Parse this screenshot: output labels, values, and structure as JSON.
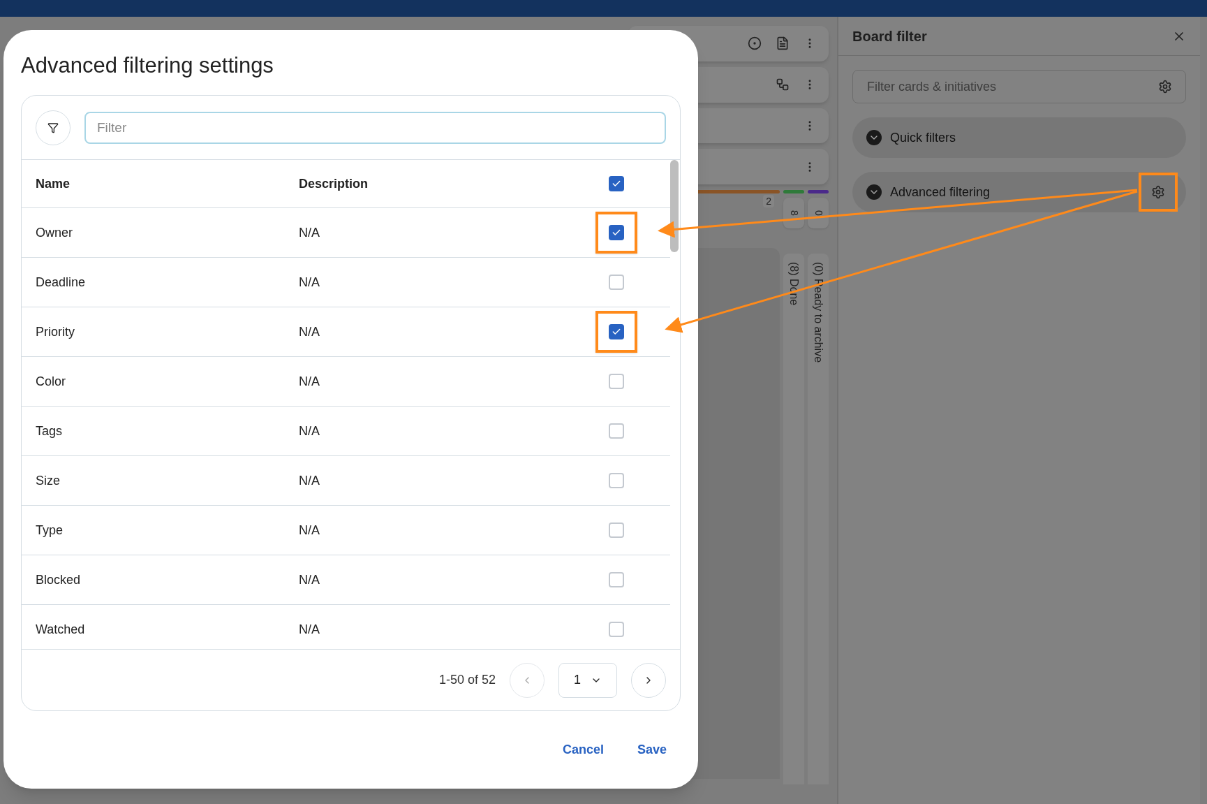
{
  "board": {
    "cards": [
      {
        "kind": "target"
      },
      {
        "kind": "workflow"
      },
      {
        "kind": "plain"
      },
      {
        "kind": "plain"
      }
    ],
    "lanes": [
      {
        "color": "#8a5426",
        "count": "2"
      },
      {
        "color": "#2f7a3a",
        "count": "8",
        "title": "(8) Done"
      },
      {
        "color": "#4b2a8a",
        "count": "0",
        "title": "(0) Ready to archive"
      }
    ]
  },
  "board_filter": {
    "title": "Board filter",
    "search": {
      "placeholder": "Filter cards & initiatives"
    },
    "sections": [
      {
        "label": "Quick filters",
        "highlighted": false
      },
      {
        "label": "Advanced filtering",
        "highlighted": true
      }
    ]
  },
  "dialog": {
    "title": "Advanced filtering settings",
    "filter": {
      "placeholder": "Filter"
    },
    "columns": [
      "Name",
      "Description"
    ],
    "select_all": {
      "checked": true
    },
    "rows": [
      {
        "name": "Owner",
        "description": "N/A",
        "checked": true,
        "highlighted": true
      },
      {
        "name": "Deadline",
        "description": "N/A",
        "checked": false,
        "highlighted": false
      },
      {
        "name": "Priority",
        "description": "N/A",
        "checked": true,
        "highlighted": true
      },
      {
        "name": "Color",
        "description": "N/A",
        "checked": false,
        "highlighted": false
      },
      {
        "name": "Tags",
        "description": "N/A",
        "checked": false,
        "highlighted": false
      },
      {
        "name": "Size",
        "description": "N/A",
        "checked": false,
        "highlighted": false
      },
      {
        "name": "Type",
        "description": "N/A",
        "checked": false,
        "highlighted": false
      },
      {
        "name": "Blocked",
        "description": "N/A",
        "checked": false,
        "highlighted": false
      },
      {
        "name": "Watched",
        "description": "N/A",
        "checked": false,
        "highlighted": false
      }
    ],
    "pagination": {
      "range": "1-50 of 52",
      "page": "1"
    },
    "buttons": [
      "Cancel",
      "Save"
    ]
  }
}
